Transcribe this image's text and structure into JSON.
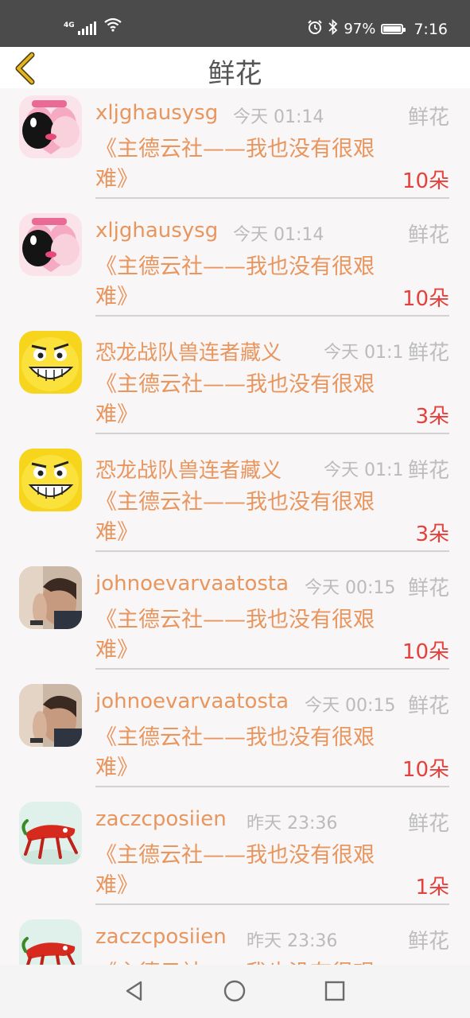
{
  "status_bar": {
    "network": "4G",
    "battery": "97%",
    "battery_level": 0.97,
    "time": "7:16",
    "icons": [
      "signal-icon",
      "wifi-icon",
      "alarm-icon",
      "bluetooth-icon",
      "battery-icon"
    ]
  },
  "header": {
    "title": "鲜花",
    "back_icon": "chevron-left-icon"
  },
  "items": [
    {
      "user": "xljghausysg",
      "time": "今天 01:14",
      "tag": "鲜花",
      "work": "《主德云社——我也没有很艰难》",
      "count": "10朵",
      "avatar": "kiss-sticker"
    },
    {
      "user": "xljghausysg",
      "time": "今天 01:14",
      "tag": "鲜花",
      "work": "《主德云社——我也没有很艰难》",
      "count": "10朵",
      "avatar": "kiss-sticker"
    },
    {
      "user": "恐龙战队兽连者藏义",
      "time": "今天 01:1",
      "tag": "鲜花",
      "work": "《主德云社——我也没有很艰难》",
      "count": "3朵",
      "avatar": "smiley"
    },
    {
      "user": "恐龙战队兽连者藏义",
      "time": "今天 01:1",
      "tag": "鲜花",
      "work": "《主德云社——我也没有很艰难》",
      "count": "3朵",
      "avatar": "smiley"
    },
    {
      "user": "johnoevarvaatosta",
      "time": "今天 00:15",
      "tag": "鲜花",
      "work": "《主德云社——我也没有很艰难》",
      "count": "10朵",
      "avatar": "man-photo"
    },
    {
      "user": "johnoevarvaatosta",
      "time": "今天 00:15",
      "tag": "鲜花",
      "work": "《主德云社——我也没有很艰难》",
      "count": "10朵",
      "avatar": "man-photo"
    },
    {
      "user": "zaczcposiien",
      "time": "昨天 23:36",
      "tag": "鲜花",
      "work": "《主德云社——我也没有很艰难》",
      "count": "1朵",
      "avatar": "chili"
    },
    {
      "user": "zaczcposiien",
      "time": "昨天 23:36",
      "tag": "鲜花",
      "work": "《主德云社——我也没有很艰难》",
      "count": "",
      "avatar": "chili"
    }
  ],
  "nav": {
    "back": "triangle-back-icon",
    "home": "circle-home-icon",
    "recent": "square-recent-icon"
  },
  "colors": {
    "accent": "#e8965e",
    "count": "#e5403b",
    "status_bar": "#4b4b4b",
    "back_arrow": "#e2b420"
  }
}
